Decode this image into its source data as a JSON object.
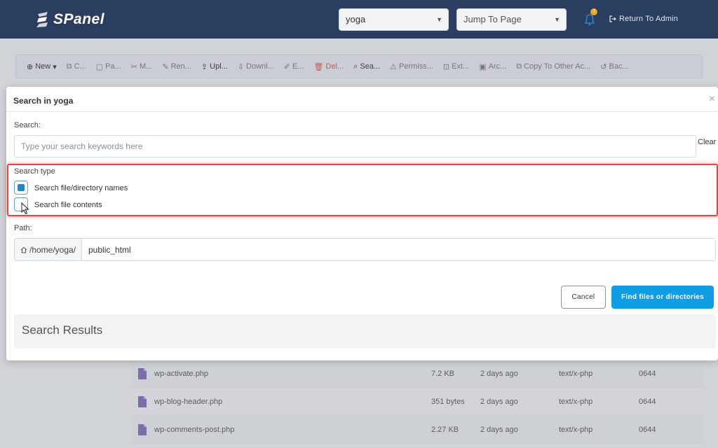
{
  "topbar": {
    "logo_text": "SPanel",
    "account_select": "yoga",
    "jump_select": "Jump To Page",
    "notification_count": "3",
    "return_admin": "Return To Admin"
  },
  "toolbar": {
    "items": [
      "New",
      "C...",
      "Pa...",
      "M...",
      "Ren...",
      "Upl...",
      "Downl...",
      "E...",
      "Del...",
      "Sea...",
      "Permiss...",
      "Ext...",
      "Arc...",
      "Copy To Other Ac...",
      "Bac..."
    ]
  },
  "files": [
    {
      "name": "wp-activate.php",
      "size": "7.2 KB",
      "modified": "2 days ago",
      "type": "text/x-php",
      "perms": "0644"
    },
    {
      "name": "wp-blog-header.php",
      "size": "351 bytes",
      "modified": "2 days ago",
      "type": "text/x-php",
      "perms": "0644"
    },
    {
      "name": "wp-comments-post.php",
      "size": "2.27 KB",
      "modified": "2 days ago",
      "type": "text/x-php",
      "perms": "0644"
    }
  ],
  "modal": {
    "title": "Search in yoga",
    "search_label": "Search:",
    "search_placeholder": "Type your search keywords here",
    "clear": "Clear",
    "search_type_label": "Search type",
    "option_names": "Search file/directory names",
    "option_names_checked": true,
    "option_contents": "Search file contents",
    "option_contents_checked": false,
    "path_label": "Path:",
    "path_prefix": "/home/yoga/",
    "path_value": "public_html",
    "cancel": "Cancel",
    "find": "Find files or directories",
    "results_title": "Search Results"
  },
  "colors": {
    "topbar": "#2c3e5f",
    "primary": "#0d9ee6",
    "highlight": "#e84545"
  }
}
